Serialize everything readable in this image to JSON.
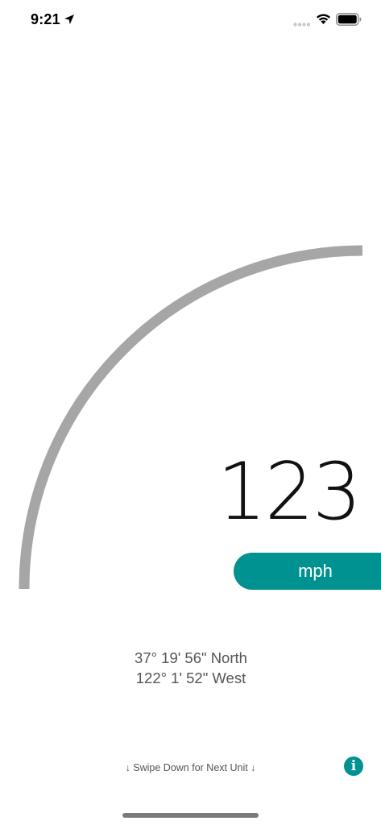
{
  "status_bar": {
    "time": "9:21",
    "icons": [
      "location-arrow-icon",
      "signal-icon",
      "wifi-icon",
      "battery-icon"
    ]
  },
  "gauge": {
    "level": 0,
    "track_color": "#a6a6a6"
  },
  "speed": {
    "value": "123",
    "unit": "mph",
    "accent_color": "#009191"
  },
  "location": {
    "latitude": "37° 19' 56\" North",
    "longitude": "122° 1' 52\" West"
  },
  "hint": {
    "text": "↓ Swipe Down for Next Unit ↓"
  },
  "info": {
    "icon": "info-icon",
    "glyph": "i"
  }
}
